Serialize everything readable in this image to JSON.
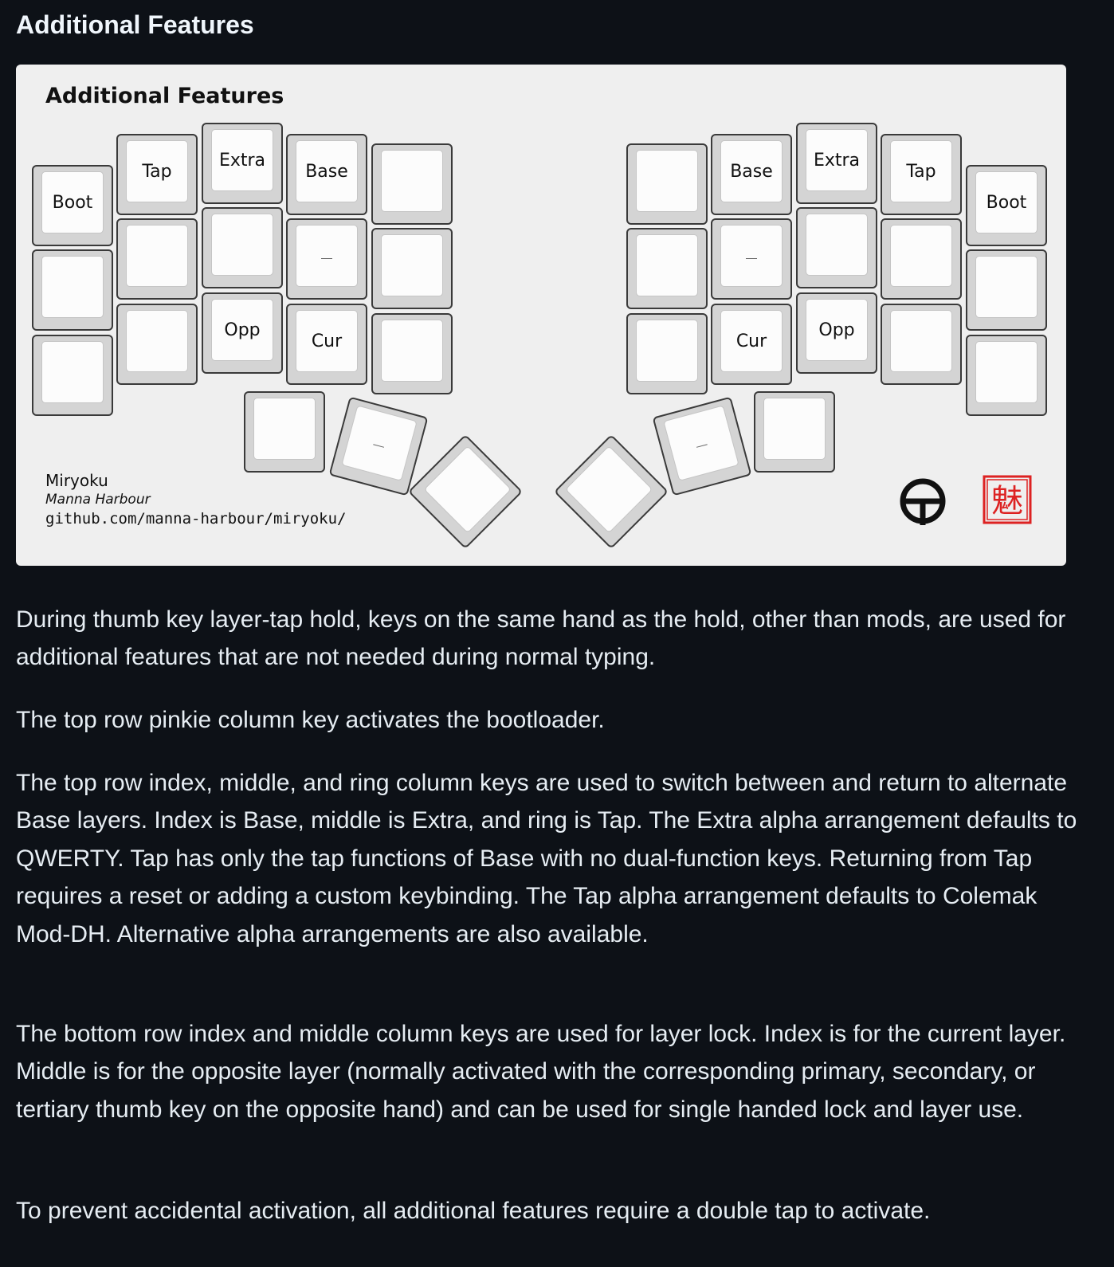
{
  "heading": "Additional Features",
  "diagram": {
    "title": "Additional Features",
    "credit_name": "Miryoku",
    "credit_author": "Manna Harbour",
    "credit_url": "github.com/manna-harbour/miryoku/",
    "seal_text": "魅",
    "left_keys": [
      "Boot",
      "Tap",
      "Extra",
      "Base",
      "",
      "",
      "",
      "",
      "",
      "",
      "",
      "",
      "Opp",
      "Cur",
      "",
      "",
      "",
      ""
    ],
    "right_keys": [
      "",
      "Base",
      "Extra",
      "Tap",
      "Boot",
      "",
      "",
      "",
      "",
      "",
      "",
      "Cur",
      "Opp",
      "",
      "",
      "",
      "",
      ""
    ],
    "colors": {
      "seal": "#dd2222",
      "symbol": "#111111",
      "panel": "#efefef",
      "background": "#0d1117"
    }
  },
  "paragraphs": [
    "During thumb key layer-tap hold, keys on the same hand as the hold, other than mods, are used for additional features that are not needed during normal typing.",
    "The top row pinkie column key activates the bootloader.",
    "The top row index, middle, and ring column keys are used to switch between and return to alternate Base layers. Index is Base, middle is Extra, and ring is Tap. The Extra alpha arrangement defaults to QWERTY. Tap has only the tap functions of Base with no dual-function keys. Returning from Tap requires a reset or adding a custom keybinding. The Tap alpha arrangement defaults to Colemak Mod-DH. Alternative alpha arrangements are also available.",
    "The bottom row index and middle column keys are used for layer lock. Index is for the current layer. Middle is for the opposite layer (normally activated with the corresponding primary, secondary, or tertiary thumb key on the opposite hand) and can be used for single handed lock and layer use.",
    "To prevent accidental activation, all additional features require a double tap to activate."
  ]
}
